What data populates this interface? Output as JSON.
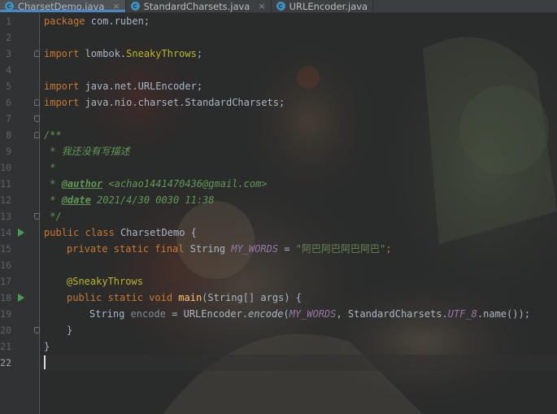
{
  "tabs": [
    {
      "label": "CharsetDemo.java",
      "active": true
    },
    {
      "label": "StandardCharsets.java",
      "active": false
    },
    {
      "label": "URLEncoder.java",
      "active": false
    }
  ],
  "close_glyph": "×",
  "line_numbers": [
    "1",
    "2",
    "3",
    "4",
    "5",
    "6",
    "7",
    "8",
    "9",
    "10",
    "11",
    "12",
    "13",
    "14",
    "15",
    "16",
    "17",
    "18",
    "19",
    "20",
    "21",
    "22"
  ],
  "code": {
    "l1": {
      "kw": "package",
      "rest": " com.ruben;"
    },
    "l3": {
      "kw": "import",
      "pkg": " lombok.",
      "cls": "SneakyThrows",
      "semi": ";"
    },
    "l5": {
      "kw": "import",
      "rest": " java.net.URLEncoder;"
    },
    "l6": {
      "kw": "import",
      "rest": " java.nio.charset.StandardCharsets;"
    },
    "l8": {
      "text": "/**"
    },
    "l9": {
      "text": " * 我还没有写描述"
    },
    "l10": {
      "text": " *"
    },
    "l11": {
      "prefix": " * ",
      "tag": "@author",
      "value": " <achao1441470436@gmail.com>"
    },
    "l12": {
      "prefix": " * ",
      "tag": "@date",
      "value": " 2021/4/30 0030 11:38"
    },
    "l13": {
      "text": " */"
    },
    "l14": {
      "kw1": "public",
      "kw2": "class",
      "name": " CharsetDemo {"
    },
    "l15": {
      "kw": "private static final",
      "type": " String ",
      "field": "MY_WORDS",
      "eq": " = ",
      "str": "\"阿巴阿巴阿巴阿巴\"",
      "semi": ";"
    },
    "l17": {
      "ann": "@SneakyThrows"
    },
    "l18": {
      "kw": "public static void",
      "fn": " main",
      "sig": "(String[] args) {"
    },
    "l19": {
      "type": "String ",
      "var": "encode",
      "eq": " = URLEncoder.",
      "call": "encode",
      "open": "(",
      "field": "MY_WORDS",
      "mid": ", StandardCharsets.",
      "const": "UTF_8",
      "tail": ".name());"
    },
    "l20": {
      "text": "}"
    },
    "l21": {
      "text": "}"
    }
  },
  "colors": {
    "background": "#2b2b2b",
    "keyword": "#cc7832",
    "string": "#6a8759",
    "comment": "#629755",
    "annotation": "#bbb529",
    "field": "#9876aa",
    "function": "#ffc66d",
    "run_icon": "#499c54"
  },
  "icons": [
    "java-file-icon",
    "close-icon",
    "run-gutter-icon",
    "fold-icon"
  ]
}
